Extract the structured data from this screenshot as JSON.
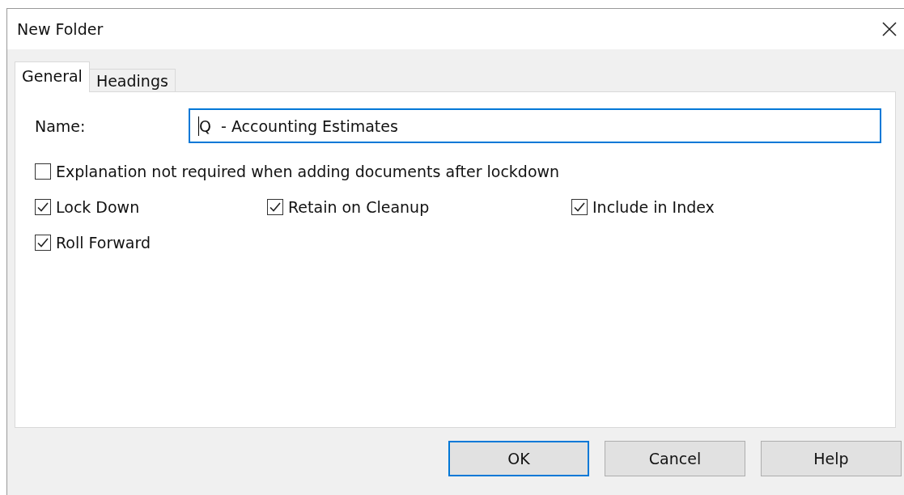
{
  "window": {
    "title": "New Folder"
  },
  "tabs": [
    {
      "label": "General",
      "selected": true
    },
    {
      "label": "Headings",
      "selected": false
    }
  ],
  "name_field": {
    "label": "Name:",
    "value": "Q  - Accounting Estimates",
    "focused": true
  },
  "option_rows": [
    [
      {
        "label": "Explanation not required when adding documents after lockdown",
        "checked": false
      }
    ],
    [
      {
        "label": "Lock Down",
        "checked": true
      },
      {
        "label": "Retain on Cleanup",
        "checked": true
      },
      {
        "label": "Include in Index",
        "checked": true
      }
    ],
    [
      {
        "label": "Roll Forward",
        "checked": true
      }
    ]
  ],
  "buttons": [
    {
      "label": "OK",
      "default": true
    },
    {
      "label": "Cancel",
      "default": false
    },
    {
      "label": "Help",
      "default": false
    }
  ]
}
